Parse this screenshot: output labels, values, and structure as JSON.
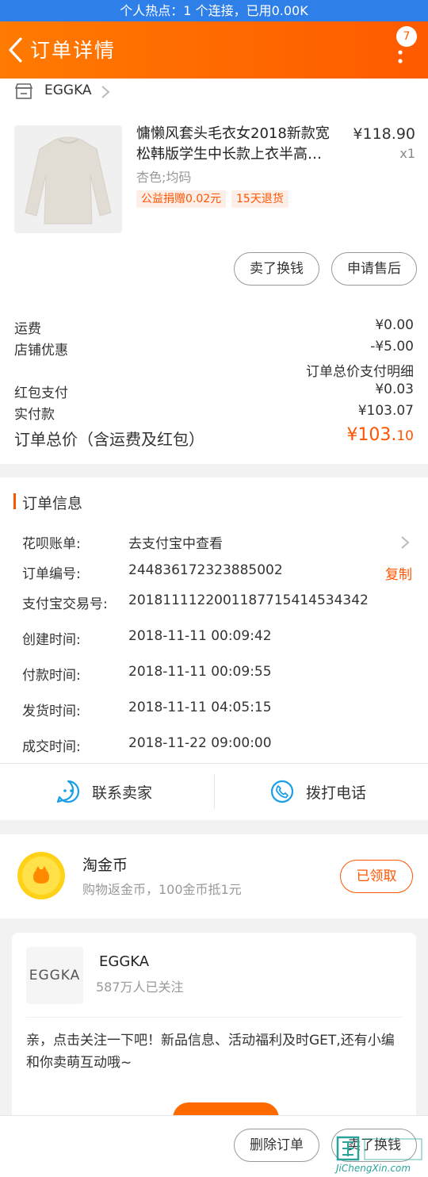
{
  "status_bar": {
    "hotspot_text": "个人热点：1 个连接，已用0.00K"
  },
  "header": {
    "title": "订单详情",
    "badge_count": "7"
  },
  "shop": {
    "name": "EGGKA"
  },
  "product": {
    "title": "慵懒风套头毛衣女2018新款宽松韩版学生中长款上衣半高…",
    "price": "¥118.90",
    "quantity": "x1",
    "sku": "杏色;均码",
    "tags": [
      "公益捐赠0.02元",
      "15天退货"
    ]
  },
  "item_actions": {
    "sell_swap": "卖了换钱",
    "after_sale": "申请售后"
  },
  "fees": {
    "shipping_label": "运费",
    "shipping_value": "¥0.00",
    "discount_label": "店铺优惠",
    "discount_value": "-¥5.00",
    "detail_link": "订单总价支付明细",
    "redpacket_label": "红包支付",
    "redpacket_value": "¥0.03",
    "paid_label": "实付款",
    "paid_value": "¥103.07",
    "total_label": "订单总价（含运费及红包）",
    "total_main": "¥103.",
    "total_cents": "10"
  },
  "order_info": {
    "section_title": "订单信息",
    "copy_label": "复制",
    "rows": [
      {
        "label": "花呗账单:",
        "value": "去支付宝中查看"
      },
      {
        "label": "订单编号:",
        "value": "244836172323885002"
      },
      {
        "label": "支付宝交易号:",
        "value": "2018111122001187715414534342"
      },
      {
        "label": "创建时间:",
        "value": "2018-11-11 00:09:42"
      },
      {
        "label": "付款时间:",
        "value": "2018-11-11 00:09:55"
      },
      {
        "label": "发货时间:",
        "value": "2018-11-11 04:05:15"
      },
      {
        "label": "成交时间:",
        "value": "2018-11-22 09:00:00"
      }
    ]
  },
  "contact": {
    "seller": "联系卖家",
    "phone": "拨打电话"
  },
  "coins": {
    "title": "淘金币",
    "subtitle": "购物返金币，100金币抵1元",
    "button": "已领取"
  },
  "follow": {
    "logo_text": "EGGKA",
    "shop_name": "EGGKA",
    "followers": "587万人已关注",
    "message": "亲，点击关注一下吧！新品信息、活动福利及时GET,还有小编和你卖萌互动哦~"
  },
  "bottom_actions": {
    "delete": "删除订单",
    "sell_swap": "卖了换钱"
  },
  "watermark": {
    "site": "JiChengXin.com"
  },
  "colors": {
    "accent": "#ff5500",
    "header_gradient_start": "#ff7a00",
    "status_blue": "#2f7fe8"
  }
}
